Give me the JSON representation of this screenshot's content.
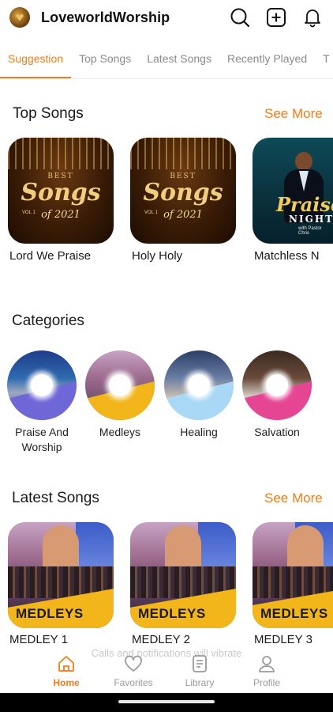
{
  "header": {
    "app_title": "LoveworldWorship",
    "icons": [
      "logo-icon",
      "search-icon",
      "add-icon",
      "bell-icon"
    ]
  },
  "tabs": [
    {
      "label": "Suggestion",
      "active": true
    },
    {
      "label": "Top Songs",
      "active": false
    },
    {
      "label": "Latest Songs",
      "active": false
    },
    {
      "label": "Recently Played",
      "active": false
    },
    {
      "label": "T",
      "active": false
    }
  ],
  "top_songs": {
    "title": "Top Songs",
    "see_more": "See More",
    "items": [
      {
        "label": "Lord We Praise",
        "art": {
          "best": "BEST",
          "songs": "Songs",
          "year": "of 2021",
          "vol": "VOL 1"
        }
      },
      {
        "label": "Holy Holy",
        "art": {
          "best": "BEST",
          "songs": "Songs",
          "year": "of 2021",
          "vol": "VOL 1"
        }
      },
      {
        "label": "Matchless N",
        "art": {
          "praise": "Praise",
          "night": "NIGHT",
          "by": "with Pastor Chris"
        }
      }
    ]
  },
  "categories": {
    "title": "Categories",
    "items": [
      {
        "label": "Praise And Worship",
        "band_color": "#6f66d8"
      },
      {
        "label": "Medleys",
        "band_color": "#f2b61b"
      },
      {
        "label": "Healing",
        "band_color": "#a8d8f5"
      },
      {
        "label": "Salvation",
        "band_color": "#e64594"
      }
    ]
  },
  "latest_songs": {
    "title": "Latest Songs",
    "see_more": "See More",
    "items": [
      {
        "label": "MEDLEY 1",
        "art_text": "MEDLEYS"
      },
      {
        "label": "MEDLEY 2",
        "art_text": "MEDLEYS"
      },
      {
        "label": "MEDLEY 3",
        "art_text": "MEDLEYS"
      }
    ]
  },
  "toast": "Calls and notifications will vibrate",
  "bottom_nav": [
    {
      "label": "Home",
      "icon": "home-icon",
      "active": true
    },
    {
      "label": "Favorites",
      "icon": "heart-icon",
      "active": false
    },
    {
      "label": "Library",
      "icon": "library-icon",
      "active": false
    },
    {
      "label": "Profile",
      "icon": "profile-icon",
      "active": false
    }
  ],
  "colors": {
    "accent": "#f07d1b",
    "text": "#1a1a1a",
    "muted": "#8a8a8a"
  }
}
